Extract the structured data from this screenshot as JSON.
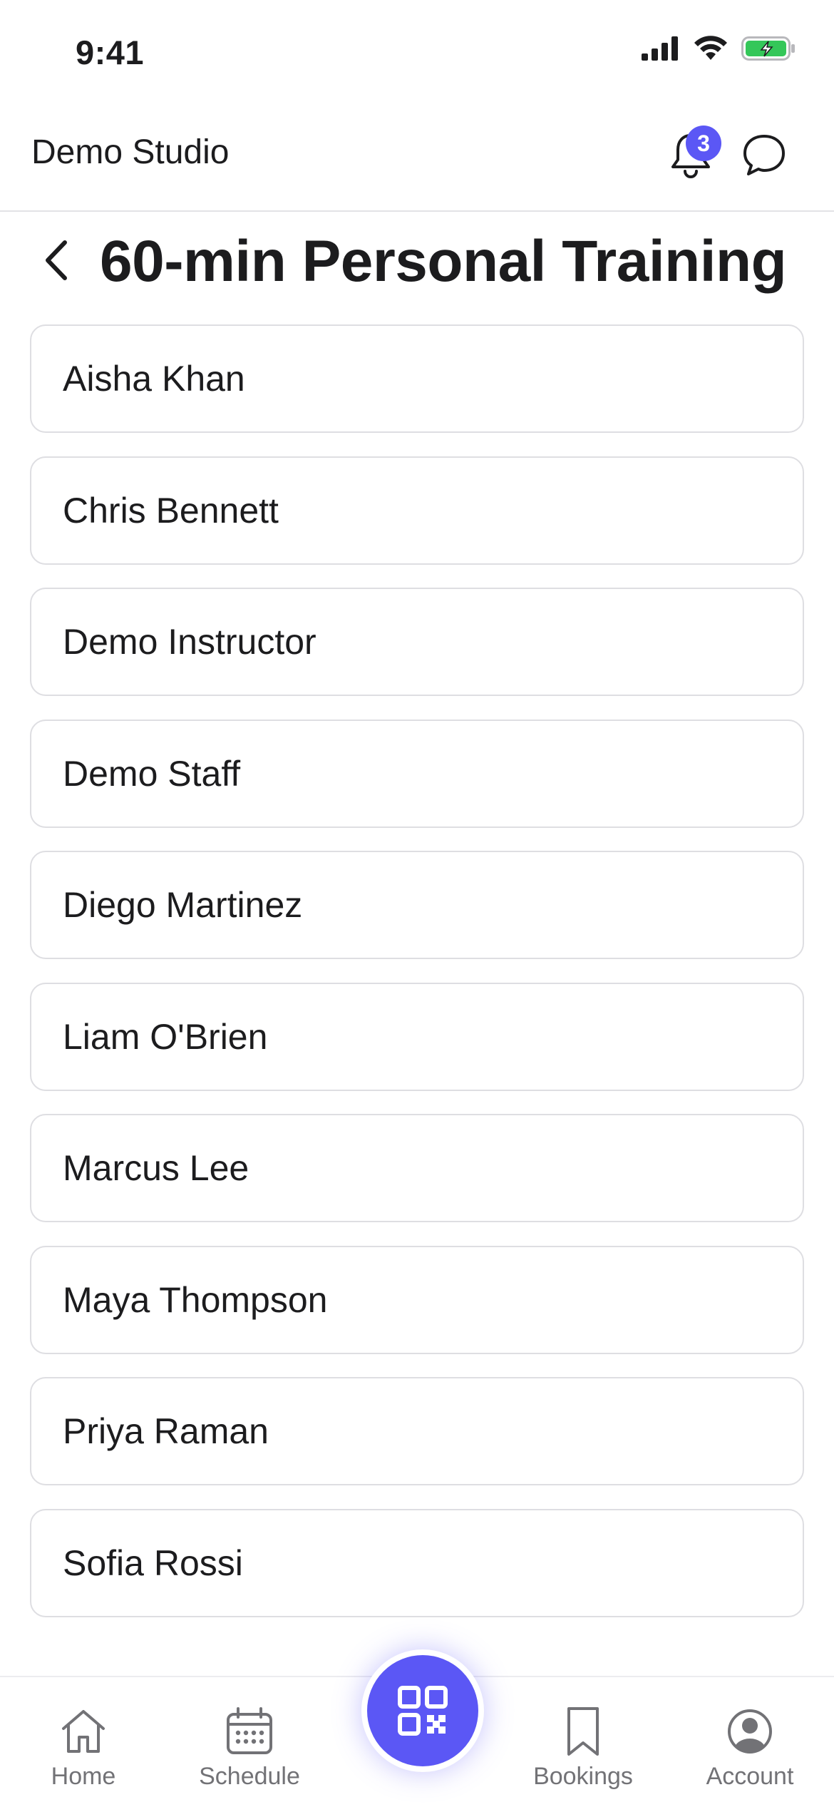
{
  "status_bar": {
    "time": "9:41",
    "icons": [
      "signal-icon",
      "wifi-icon",
      "battery-charging-icon"
    ],
    "battery_color": "#34c759"
  },
  "header": {
    "studio_name": "Demo Studio",
    "notification_count": "3",
    "icons": [
      "bell-icon",
      "chat-bubble-icon"
    ],
    "accent_color": "#5b57f5"
  },
  "page": {
    "title": "60-min Personal Training",
    "back_icon": "chevron-left-icon"
  },
  "staff": [
    {
      "name": "Aisha Khan"
    },
    {
      "name": "Chris Bennett"
    },
    {
      "name": "Demo Instructor"
    },
    {
      "name": "Demo Staff"
    },
    {
      "name": "Diego Martinez"
    },
    {
      "name": "Liam O'Brien"
    },
    {
      "name": "Marcus Lee"
    },
    {
      "name": "Maya Thompson"
    },
    {
      "name": "Priya Raman"
    },
    {
      "name": "Sofia Rossi"
    }
  ],
  "tab_bar": {
    "tabs": [
      {
        "label": "Home",
        "icon": "home-icon"
      },
      {
        "label": "Schedule",
        "icon": "calendar-icon"
      },
      {
        "label": "Bookings",
        "icon": "bookmark-icon"
      },
      {
        "label": "Account",
        "icon": "account-icon"
      }
    ],
    "center_action_icon": "qr-code-icon"
  }
}
